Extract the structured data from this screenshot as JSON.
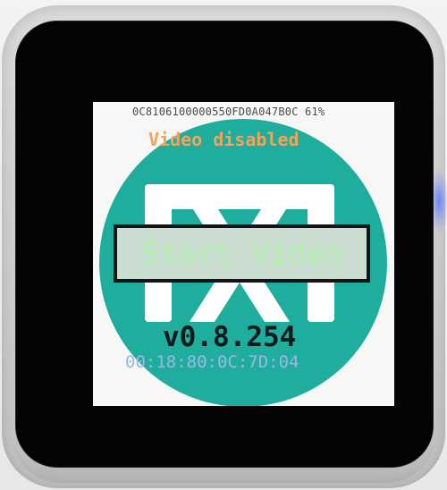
{
  "screen": {
    "device_id": "0C8106100000550FD0A047B0C 61%",
    "status_text": "Video disabled",
    "start_button_label": "Start Video",
    "version": "v0.8.254",
    "mac_address": "00:18:80:0C:7D:04"
  },
  "colors": {
    "logo_circle": "#1fae9e",
    "logo_mark": "#ffffff",
    "status_text": "#f2a35c",
    "start_button_fill": "#c9ddd0",
    "start_button_border": "#141414",
    "start_button_text": "#b7efb1",
    "version_text": "#0f1a1c",
    "mac_text": "#9ab8e4",
    "bezel": "#050505",
    "casing": "#d4d4d4"
  },
  "icons": [
    "logo-icon"
  ]
}
